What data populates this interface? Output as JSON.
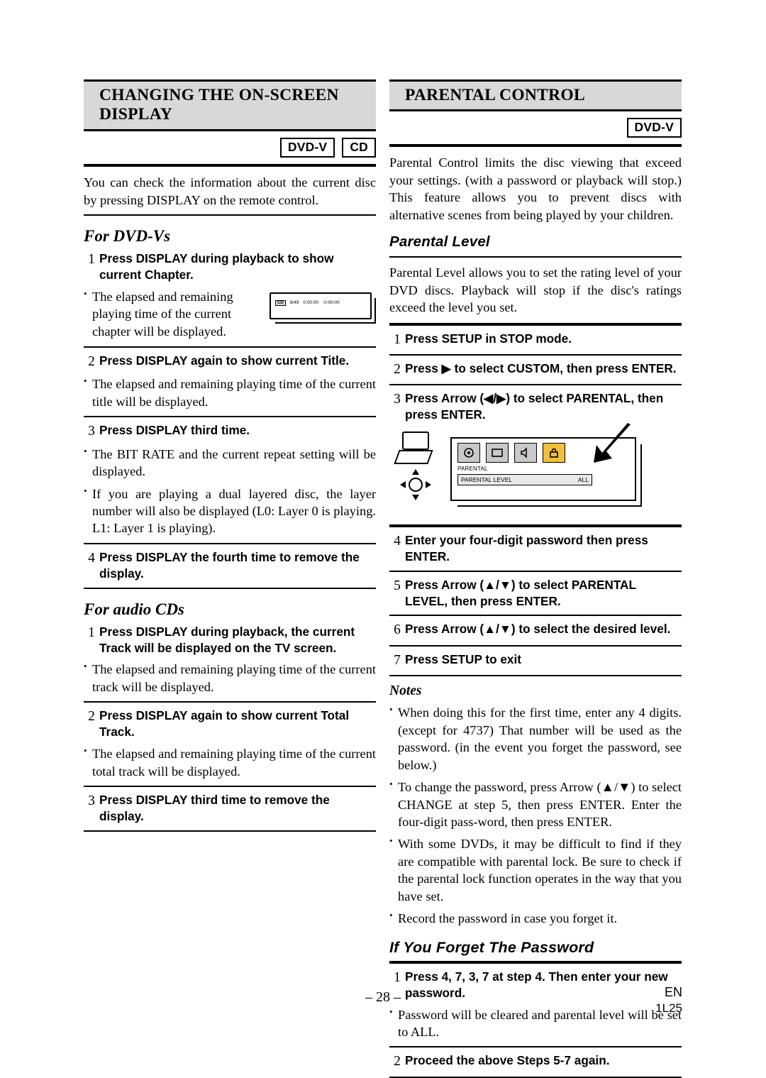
{
  "left_column": {
    "banner_title": "Changing the On-Screen Display",
    "badges": [
      "DVD-V",
      "CD"
    ],
    "intro": "You can check the information about the current disc by pressing DISPLAY on the remote control.",
    "section1_heading": "For DVD-Vs",
    "steps1": [
      {
        "num": "1",
        "text": "Press DISPLAY during playback to show current Chapter."
      },
      {
        "num": "2",
        "text": "Press DISPLAY again to show current Title."
      },
      {
        "num": "3",
        "text": "Press DISPLAY third time."
      },
      {
        "num": "4",
        "text": "Press DISPLAY the fourth time to remove the display."
      }
    ],
    "bullet_1_1": "The elapsed and remaining playing time of the current chapter will be displayed.",
    "bullet_2_1": "The elapsed and remaining playing time of the current title will be displayed.",
    "bullet_3_1": "The BIT RATE and the current repeat setting will be displayed.",
    "bullet_3_2": "If you are playing a dual layered disc, the layer number will also be displayed (L0: Layer 0 is playing. L1: Layer 1 is playing).",
    "osd_figure": {
      "disc_label": "CD",
      "track": "9/49",
      "elapsed": "0:00:00",
      "remaining": "-0:00:00"
    },
    "section2_heading": "For audio CDs",
    "steps2": [
      {
        "num": "1",
        "text": "Press DISPLAY during playback, the current Track will be displayed on the TV screen."
      },
      {
        "num": "2",
        "text": "Press DISPLAY again to show current Total Track."
      },
      {
        "num": "3",
        "text": "Press DISPLAY third time to remove the display."
      }
    ],
    "bullet_c1": "The elapsed and remaining playing time of the current track will be displayed.",
    "bullet_c2": "The elapsed and remaining playing time of the current total track will be displayed."
  },
  "right_column": {
    "banner_title": "Parental Control",
    "badge": "DVD-V",
    "intro": "Parental Control limits the disc viewing that exceed your settings. (with a password or playback will stop.) This feature allows you to prevent discs with alternative scenes from being played by your children.",
    "parental_level_heading": "Parental Level",
    "parental_level_intro": "Parental Level allows you to set the rating level of your DVD discs. Playback will stop if the disc's ratings exceed the level you set.",
    "steps": [
      {
        "num": "1",
        "text": "Press SETUP in STOP mode."
      },
      {
        "num": "2",
        "text": "Press ▶ to select CUSTOM, then press ENTER."
      },
      {
        "num": "3",
        "text": "Press Arrow (◀/▶) to select PARENTAL, then press ENTER."
      },
      {
        "num": "4",
        "text": "Enter your four-digit password then press ENTER."
      },
      {
        "num": "5",
        "text": "Press Arrow (▲/▼) to select PARENTAL LEVEL, then press ENTER."
      },
      {
        "num": "6",
        "text": "Press Arrow (▲/▼) to select the desired level."
      },
      {
        "num": "7",
        "text": "Press SETUP to exit"
      }
    ],
    "figure": {
      "menu_caption": "PARENTAL",
      "row_label": "PARENTAL LEVEL",
      "row_value": "ALL"
    },
    "notes_label": "Notes",
    "notes": [
      "When doing this for the first time, enter any 4 digits. (except for 4737) That number will be used as the password. (in the event you forget the password, see below.)",
      "To change the password, press Arrow (▲/▼) to select CHANGE at step 5, then press ENTER. Enter the four-digit pass-word, then press ENTER.",
      "With some DVDs, it may be difficult to find if they are compatible with parental lock. Be sure to check if the parental lock function operates in the way that you have set.",
      "Record the password in case you forget it."
    ],
    "forget_heading": "If You Forget The Password",
    "forget_steps": [
      {
        "num": "1",
        "text": "Press 4, 7, 3, 7 at step 4. Then enter your new password."
      },
      {
        "num": "2",
        "text": "Proceed the above Steps 5-7 again."
      }
    ],
    "forget_bullet": "Password will be cleared and parental level will be set to ALL."
  },
  "footer": {
    "page_number": "– 28 –",
    "lang": "EN",
    "code": "1L25"
  }
}
